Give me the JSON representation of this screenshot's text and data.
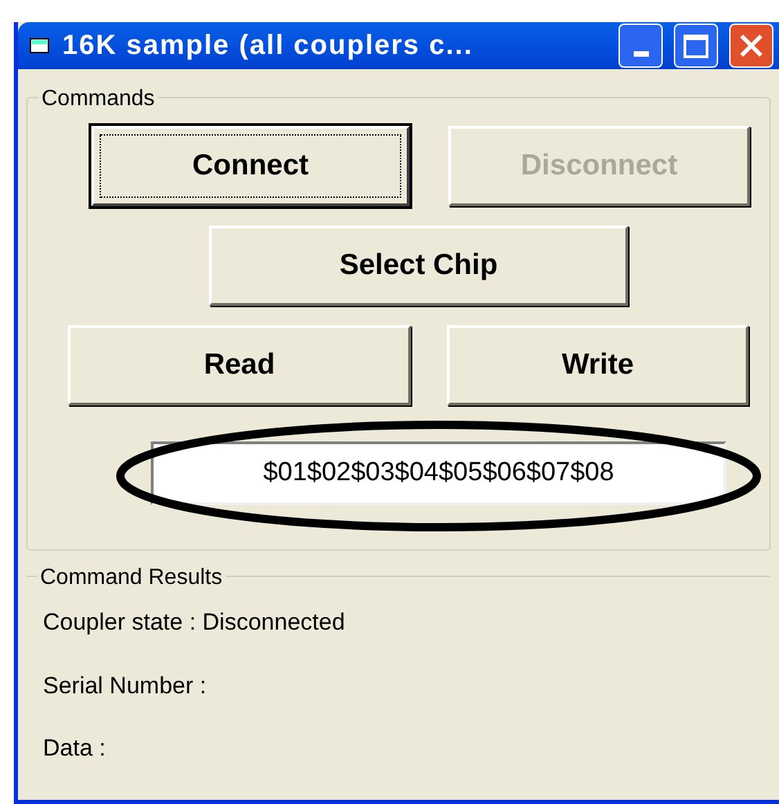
{
  "window": {
    "title": "16K sample (all couplers c..."
  },
  "commands": {
    "title": "Commands",
    "buttons": [
      {
        "label": "Connect",
        "disabled": false,
        "focused": true
      },
      {
        "label": "Disconnect",
        "disabled": true,
        "focused": false
      },
      {
        "label": "Select Chip",
        "disabled": false,
        "focused": false
      },
      {
        "label": "Read",
        "disabled": false,
        "focused": false
      },
      {
        "label": "Write",
        "disabled": false,
        "focused": false
      }
    ],
    "data_field": {
      "value": "$01$02$03$04$05$06$07$08",
      "highlighted": true
    }
  },
  "results": {
    "title": "Command Results",
    "lines": [
      "Coupler state : Disconnected",
      "Serial Number :",
      "Data :"
    ]
  }
}
